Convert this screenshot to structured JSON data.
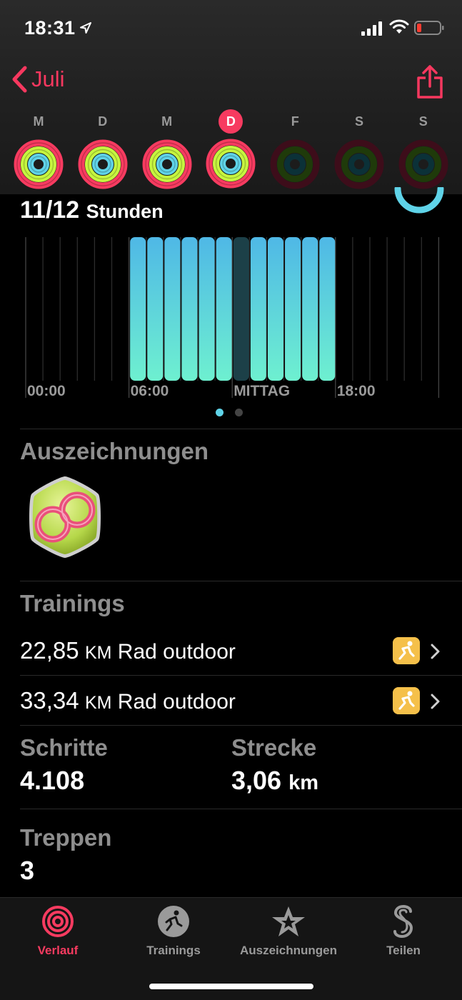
{
  "status_bar": {
    "time": "18:31",
    "battery_color": "#ff3b30"
  },
  "nav": {
    "back_label": "Juli",
    "accent": "#f7385f"
  },
  "week": {
    "days": [
      {
        "letter": "M",
        "state": "complete"
      },
      {
        "letter": "D",
        "state": "complete"
      },
      {
        "letter": "M",
        "state": "complete"
      },
      {
        "letter": "D",
        "state": "today"
      },
      {
        "letter": "F",
        "state": "future"
      },
      {
        "letter": "S",
        "state": "future"
      },
      {
        "letter": "S",
        "state": "future"
      }
    ]
  },
  "stand": {
    "value": "11/12",
    "unit": "Stunden"
  },
  "hourly_chart": {
    "tick_labels": [
      "00:00",
      "06:00",
      "MITTAG",
      "18:00"
    ],
    "standing_hours": [
      6,
      7,
      8,
      9,
      10,
      11,
      13,
      14,
      15,
      16,
      17
    ],
    "missed_hours": [
      12
    ],
    "bar_color_top": "#4fb8e6",
    "bar_color_bottom": "#6ef0d0"
  },
  "awards": {
    "title": "Auszeichnungen"
  },
  "trainings": {
    "title": "Trainings",
    "items": [
      {
        "value": "22,85",
        "unit": "KM",
        "type": "Rad outdoor"
      },
      {
        "value": "33,34",
        "unit": "KM",
        "type": "Rad outdoor"
      }
    ]
  },
  "stats": {
    "steps_label": "Schritte",
    "steps_value": "4.108",
    "distance_label": "Strecke",
    "distance_value": "3,06",
    "distance_unit": "km",
    "stairs_label": "Treppen",
    "stairs_value": "3"
  },
  "tabbar": {
    "tabs": [
      {
        "label": "Verlauf",
        "icon": "activity-rings-icon",
        "active": true
      },
      {
        "label": "Trainings",
        "icon": "running-figure-icon",
        "active": false
      },
      {
        "label": "Auszeichnungen",
        "icon": "award-star-icon",
        "active": false
      },
      {
        "label": "Teilen",
        "icon": "share-s-icon",
        "active": false
      }
    ]
  }
}
